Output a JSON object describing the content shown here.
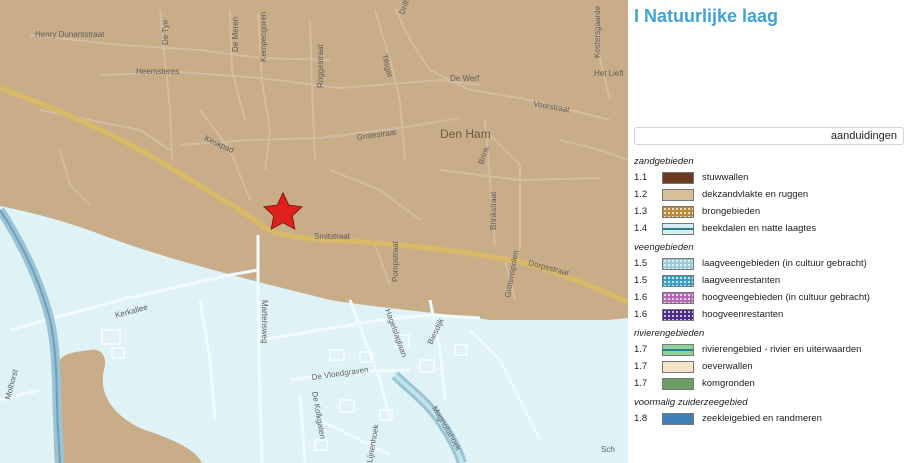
{
  "legend": {
    "title": "I Natuurlijke laag",
    "header": "aanduidingen",
    "groups": [
      {
        "name": "zandgebieden",
        "items": [
          {
            "code": "1.1",
            "label": "stuwwallen",
            "color": "#6b3a1f",
            "pattern": "solid"
          },
          {
            "code": "1.2",
            "label": "dekzandvlakte en ruggen",
            "color": "#d7bf98",
            "pattern": "solid"
          },
          {
            "code": "1.3",
            "label": "brongebieden",
            "color": "#b98a3c",
            "pattern": "dots"
          },
          {
            "code": "1.4",
            "label": "beekdalen en natte laagtes",
            "color": "#d4eef4",
            "pattern": "line"
          }
        ]
      },
      {
        "name": "veengebieden",
        "items": [
          {
            "code": "1.5",
            "label": "laagveengebieden (in cultuur gebracht)",
            "color": "#9cc9d4",
            "pattern": "dots"
          },
          {
            "code": "1.5",
            "label": "laagveenrestanten",
            "color": "#3aa0c8",
            "pattern": "dots"
          },
          {
            "code": "1.6",
            "label": "hoogveengebieden (in cultuur gebracht)",
            "color": "#b36bb5",
            "pattern": "dots"
          },
          {
            "code": "1.6",
            "label": "hoogveenrestanten",
            "color": "#4a2a8a",
            "pattern": "dots"
          }
        ]
      },
      {
        "name": "rivierengebieden",
        "items": [
          {
            "code": "1.7",
            "label": "rivierengebied - rivier en uiterwaarden",
            "color": "#8fd39a",
            "pattern": "line"
          },
          {
            "code": "1.7",
            "label": "oeverwallen",
            "color": "#f3e4c9",
            "pattern": "solid"
          },
          {
            "code": "1.7",
            "label": "komgronden",
            "color": "#6d9e68",
            "pattern": "solid"
          }
        ]
      },
      {
        "name": "voormalig zuiderzeegebied",
        "items": [
          {
            "code": "1.8",
            "label": "zeekleigebied en randmeren",
            "color": "#3f7fb8",
            "pattern": "solid"
          }
        ]
      }
    ]
  },
  "map": {
    "colors": {
      "sand": "#c8ad88",
      "brook": "#dff3f6",
      "main_road": "#d9b866",
      "road": "#d2bda0",
      "river": "#9ac4d6",
      "marker": "#e0201b"
    },
    "marker_icon": "star-icon",
    "labels": {
      "henry_dunantstraat": "Henry Dunantstraat",
      "de_tye": "De Tye",
      "de_meren": "De Meren",
      "kempengoren": "Kempengoren",
      "roggestraat": "Roggestraat",
      "drift": "Drift",
      "kostersgaarde": "Kostersgaarde",
      "heemsteres": "Heemsteres",
      "tilsgat": "Tilsgat",
      "de_werf": "De Werf",
      "het_liefland": "Het Liefl",
      "voorstraat": "Voorstraat",
      "keskpad": "Keskpad",
      "grotestraat": "Grotestraat",
      "den_ham": "Den Ham",
      "brink": "Brink",
      "smitstraat": "Smitstraat",
      "brinkstraat": "Brinkstraat",
      "pompstraat": "Pompstraat",
      "grotenspolen": "Grotenspolen",
      "dorpsstraat": "Dorpsstraat",
      "kerkallee": "Kerkallee",
      "martensweg": "Martensweg",
      "hagelslaglaan": "Hagelslaglaan",
      "biesdijk": "Biesdijk",
      "de_vloedgraven": "De Vloedgraven",
      "molhorst": "Molhorst",
      "de_kolkgaten": "De Kolkgaten",
      "lijnenhoek": "Lijnenhoek",
      "magnoliahoek": "Magnoliahoek",
      "sch": "Sch"
    }
  }
}
